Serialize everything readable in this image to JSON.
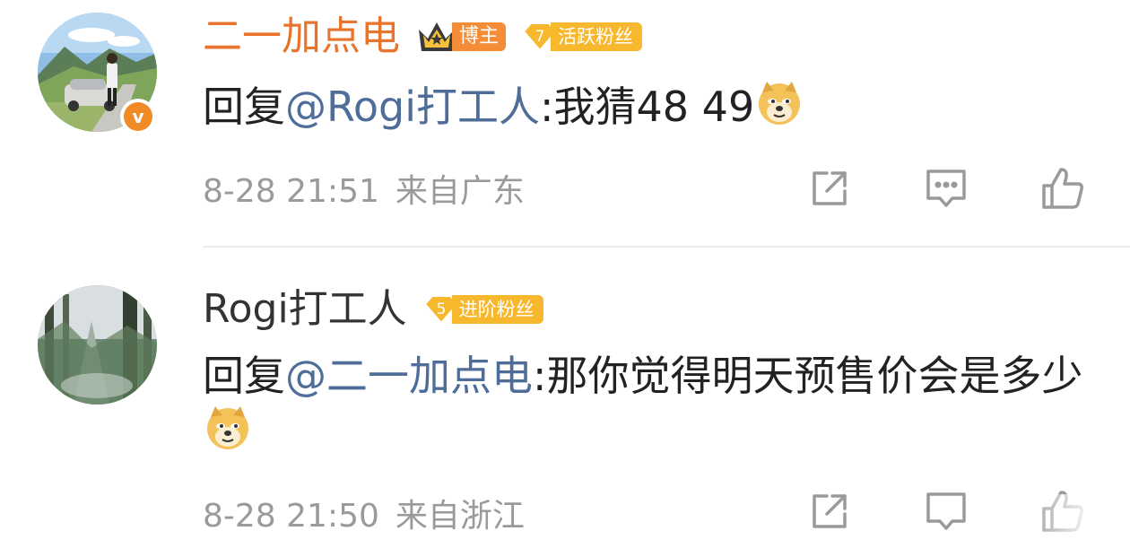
{
  "comments": [
    {
      "name": "二一加点电",
      "host_label": "博主",
      "fan_level": "7",
      "fan_label": "活跃粉丝",
      "verified": "v",
      "reply_prefix": "回复",
      "mention": "@Rogi打工人",
      "body": ":我猜48 49",
      "time": "8-28 21:51",
      "location": "来自广东",
      "emoji": "doge-emoji"
    },
    {
      "name": "Rogi打工人",
      "fan_level": "5",
      "fan_label": "进阶粉丝",
      "reply_prefix": "回复",
      "mention": "@二一加点电",
      "body": ":那你觉得明天预售价会是多少",
      "time": "8-28 21:50",
      "location": "来自浙江",
      "emoji": "doge-emoji"
    }
  ],
  "actions": [
    "share-icon",
    "comment-icon",
    "like-icon"
  ],
  "colors": {
    "author_name": "#e8742d",
    "mention": "#4f6d99",
    "meta": "#9a9a9a",
    "host_badge": "#f58c38",
    "fan_badge": "#f7b82d"
  }
}
